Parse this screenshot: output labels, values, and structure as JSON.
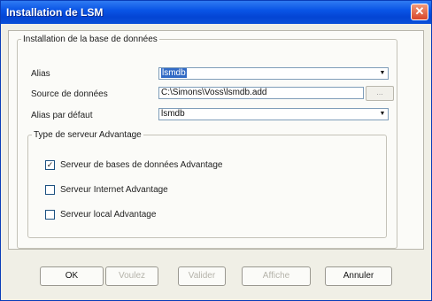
{
  "window": {
    "title": "Installation de LSM",
    "close_glyph": "✕"
  },
  "group_db": {
    "legend": "Installation de la base de données",
    "alias_label": "Alias",
    "alias_value": "lsmdb",
    "source_label": "Source de données",
    "source_value": "C:\\Simons\\Voss\\lsmdb.add",
    "browse_label": "...",
    "default_alias_label": "Alias par défaut",
    "default_alias_value": "lsmdb",
    "dropdown_glyph": "▼"
  },
  "group_server": {
    "legend": "Type de serveur Advantage",
    "options": [
      {
        "label": "Serveur de bases de données Advantage",
        "checked": true
      },
      {
        "label": "Serveur Internet Advantage",
        "checked": false
      },
      {
        "label": "Serveur local Advantage",
        "checked": false
      }
    ]
  },
  "buttons": {
    "ok": "OK",
    "previous": "Voulez",
    "validate": "Valider",
    "modify": "Affiche",
    "cancel": "Annuler"
  },
  "colors": {
    "title_bar": "#0a55e6",
    "selection": "#316ac5"
  }
}
